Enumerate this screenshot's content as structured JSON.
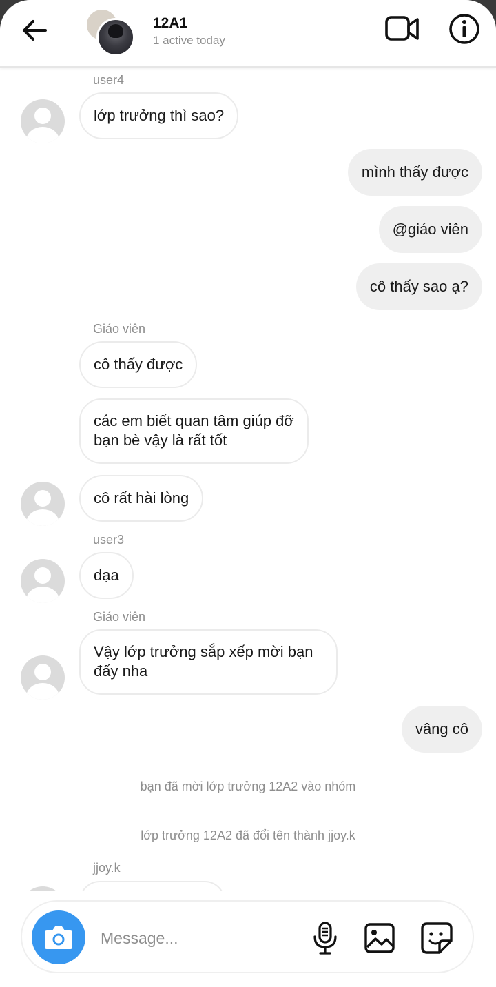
{
  "header": {
    "title": "12A1",
    "subtitle": "1 active today"
  },
  "messages": {
    "m1": {
      "sender": "user4",
      "text": "lớp trưởng thì sao?"
    },
    "m2": {
      "text": "mình thấy được"
    },
    "m3": {
      "text": "@giáo viên"
    },
    "m4": {
      "text": "cô thấy sao ạ?"
    },
    "m5": {
      "sender": "Giáo viên",
      "text": "cô thấy được"
    },
    "m6": {
      "line1": "các em biết quan tâm giúp đỡ",
      "line2": "bạn bè vậy là rất tốt"
    },
    "m7": {
      "text": "cô rất hài lòng"
    },
    "m8": {
      "sender": "user3",
      "text": "dạa"
    },
    "m9": {
      "sender": "Giáo viên",
      "line1": "Vậy lớp trưởng sắp xếp mời bạn",
      "line2": "đấy nha"
    },
    "m10": {
      "text": "vâng cô"
    },
    "sys1": "bạn đã mời lớp trưởng 12A2 vào nhóm",
    "sys2": "lớp trưởng 12A2 đã đổi tên thành jjoy.k",
    "m11": {
      "sender": "jjoy.k"
    }
  },
  "composer": {
    "placeholder": "Message..."
  },
  "icons": {
    "back": "arrow-left-icon",
    "video": "video-camera-icon",
    "info": "info-icon",
    "camera": "camera-icon",
    "mic": "microphone-icon",
    "image": "image-icon",
    "sticker": "sticker-icon"
  },
  "colors": {
    "accent": "#3797f0",
    "incoming_bubble": "#ffffff",
    "outgoing_bubble": "#efefef",
    "secondary_text": "#8e8e8e"
  }
}
